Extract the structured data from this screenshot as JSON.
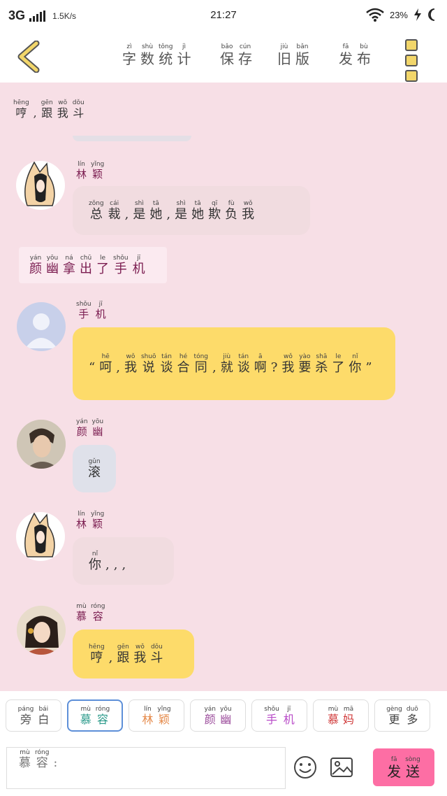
{
  "status": {
    "network": "3G",
    "speed": "1.5K/s",
    "time": "21:27",
    "battery": "23%"
  },
  "header": {
    "back_icon": "chevron-left-icon",
    "nav": [
      {
        "chars": [
          "字",
          "数",
          "统",
          "计"
        ],
        "pinyin": [
          "zì",
          "shù",
          "tǒng",
          "jì"
        ]
      },
      {
        "chars": [
          "保",
          "存"
        ],
        "pinyin": [
          "bǎo",
          "cún"
        ]
      },
      {
        "chars": [
          "旧",
          "版"
        ],
        "pinyin": [
          "jiù",
          "bǎn"
        ]
      },
      {
        "chars": [
          "发",
          "布"
        ],
        "pinyin": [
          "fā",
          "bù"
        ]
      }
    ],
    "menu_icon": "menu-icon"
  },
  "chat": {
    "top_line": {
      "chars": [
        "哼",
        ",",
        "跟",
        "我",
        "斗"
      ],
      "pinyin": [
        "hēng",
        "",
        "gēn",
        "wǒ",
        "dǒu"
      ]
    },
    "messages": [
      {
        "name": {
          "chars": [
            "林",
            "颖"
          ],
          "pinyin": [
            "lín",
            "yǐng"
          ]
        },
        "avatar": "fox-girl-avatar",
        "text": {
          "chars": [
            "总",
            "裁",
            ",",
            "是",
            "她",
            ",",
            "是",
            "她",
            "欺",
            "负",
            "我"
          ],
          "pinyin": [
            "zǒng",
            "cái",
            "",
            "shì",
            "tā",
            "",
            "shì",
            "tā",
            "qī",
            "fù",
            "wǒ"
          ]
        }
      },
      {
        "narration": {
          "chars": [
            "颜",
            "幽",
            "拿",
            "出",
            "了",
            "手",
            "机"
          ],
          "pinyin": [
            "yán",
            "yōu",
            "ná",
            "chū",
            "le",
            "shǒu",
            "jī"
          ]
        }
      },
      {
        "name": {
          "chars": [
            "手",
            "机"
          ],
          "pinyin": [
            "shǒu",
            "jī"
          ]
        },
        "avatar": "default-avatar",
        "text": {
          "chars": [
            "“",
            "呵",
            ",",
            "我",
            "说",
            "谈",
            "合",
            "同",
            ",",
            "就",
            "谈",
            "啊",
            "?",
            "我",
            "要",
            "杀",
            "了",
            "你",
            "”"
          ],
          "pinyin": [
            "",
            "hē",
            "",
            "wǒ",
            "shuō",
            "tán",
            "hé",
            "tóng",
            "",
            "jiù",
            "tán",
            "ā",
            "",
            "wǒ",
            "yào",
            "shā",
            "le",
            "nǐ",
            ""
          ]
        }
      },
      {
        "name": {
          "chars": [
            "颜",
            "幽"
          ],
          "pinyin": [
            "yán",
            "yōu"
          ]
        },
        "avatar": "man-avatar",
        "text": {
          "chars": [
            "滚"
          ],
          "pinyin": [
            "gǔn"
          ]
        }
      },
      {
        "name": {
          "chars": [
            "林",
            "颖"
          ],
          "pinyin": [
            "lín",
            "yǐng"
          ]
        },
        "avatar": "fox-girl-avatar",
        "text": {
          "chars": [
            "你",
            ",",
            ",",
            ","
          ],
          "pinyin": [
            "nǐ",
            "",
            "",
            ""
          ]
        }
      },
      {
        "name": {
          "chars": [
            "慕",
            "容"
          ],
          "pinyin": [
            "mù",
            "róng"
          ]
        },
        "avatar": "woman-avatar",
        "text": {
          "chars": [
            "哼",
            ",",
            "跟",
            "我",
            "斗"
          ],
          "pinyin": [
            "hēng",
            "",
            "gēn",
            "wǒ",
            "dǒu"
          ]
        }
      }
    ]
  },
  "bottom": {
    "characters": [
      {
        "chars": [
          "旁",
          "白"
        ],
        "pinyin": [
          "páng",
          "bái"
        ],
        "color": "#555555"
      },
      {
        "chars": [
          "慕",
          "容"
        ],
        "pinyin": [
          "mù",
          "róng"
        ],
        "color": "#2a9a8a",
        "selected": true
      },
      {
        "chars": [
          "林",
          "颖"
        ],
        "pinyin": [
          "lín",
          "yǐng"
        ],
        "color": "#e58a4a"
      },
      {
        "chars": [
          "颜",
          "幽"
        ],
        "pinyin": [
          "yán",
          "yōu"
        ],
        "color": "#9a4a9a"
      },
      {
        "chars": [
          "手",
          "机"
        ],
        "pinyin": [
          "shǒu",
          "jī"
        ],
        "color": "#b84ac8"
      },
      {
        "chars": [
          "慕",
          "妈"
        ],
        "pinyin": [
          "mù",
          "mā"
        ],
        "color": "#d03a3a"
      },
      {
        "chars": [
          "更",
          "多"
        ],
        "pinyin": [
          "gèng",
          "duō"
        ],
        "color": "#444444"
      }
    ],
    "input": {
      "chars": [
        "慕",
        "容",
        ":"
      ],
      "pinyin": [
        "mù",
        "róng",
        ""
      ]
    },
    "emoji_icon": "smiley-icon",
    "image_icon": "image-icon",
    "send": {
      "chars": [
        "发",
        "送"
      ],
      "pinyin": [
        "fā",
        "sòng"
      ]
    }
  }
}
